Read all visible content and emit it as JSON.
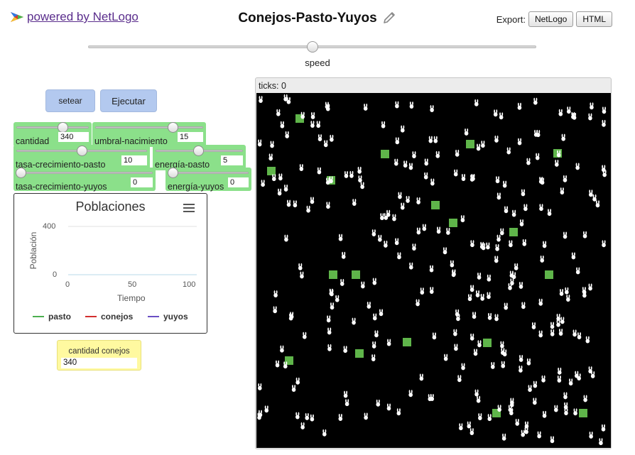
{
  "header": {
    "brand_text": "powered by NetLogo",
    "title": "Conejos-Pasto-Yuyos",
    "export_label": "Export:",
    "export_netlogo": "NetLogo",
    "export_html": "HTML"
  },
  "speed": {
    "label": "speed",
    "value": 0.5
  },
  "buttons": {
    "setup": "setear",
    "go": "Ejecutar"
  },
  "sliders": [
    {
      "label": "cantidad",
      "value": "340"
    },
    {
      "label": "umbral-nacimiento",
      "value": "15"
    },
    {
      "label": "tasa-crecimiento-pasto",
      "value": "10"
    },
    {
      "label": "energía-pasto",
      "value": "5"
    },
    {
      "label": "tasa-crecimiento-yuyos",
      "value": "0"
    },
    {
      "label": "energía-yuyos",
      "value": "0"
    }
  ],
  "plot": {
    "title": "Poblaciones",
    "ylabel": "Población",
    "xlabel": "Tiempo",
    "y_ticks": [
      "400",
      "0"
    ],
    "x_ticks": [
      "0",
      "50",
      "100"
    ],
    "legend": [
      {
        "name": "pasto",
        "color": "#4caf50"
      },
      {
        "name": "conejos",
        "color": "#d32f2f"
      },
      {
        "name": "yuyos",
        "color": "#6a4fc4"
      }
    ]
  },
  "monitor": {
    "label": "cantidad conejos",
    "value": "340"
  },
  "view": {
    "ticks_label": "ticks: 0",
    "background": "#000000",
    "grass_color": "#5fb54a",
    "rabbit_color": "#ffffff",
    "rabbit_count": 340,
    "grass_patches": 18
  }
}
